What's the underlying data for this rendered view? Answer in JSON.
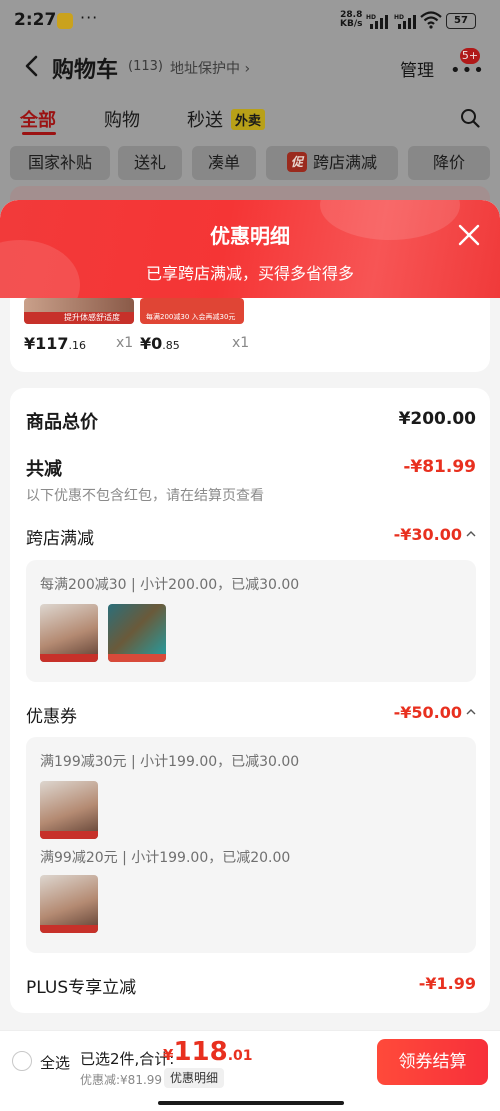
{
  "status_bar": {
    "time": "2:27",
    "more": "···",
    "speed_value": "28.8",
    "speed_unit": "KB/s",
    "battery": "57"
  },
  "header": {
    "title": "购物车",
    "count": "(113)",
    "address_protect": "地址保护中 ›",
    "manage": "管理",
    "badge": "5+"
  },
  "tabs": [
    {
      "label": "全部",
      "active": true
    },
    {
      "label": "购物",
      "active": false
    },
    {
      "label": "秒送",
      "active": false
    }
  ],
  "tab_tag": "外卖",
  "filters": [
    "国家补贴",
    "送礼",
    "凑单",
    "跨店满减",
    "降价"
  ],
  "filter_promo_icon": "促",
  "sheet": {
    "title": "优惠明细",
    "subtitle": "已享跨店满减，买得多省得多"
  },
  "items": [
    {
      "price_int": "¥117",
      "price_dec": ".16",
      "qty": "x1",
      "thumb_text": "提升体感舒适度"
    },
    {
      "price_int": "¥0",
      "price_dec": ".85",
      "qty": "x1",
      "thumb_text": "每满200减30 入会再减30元"
    }
  ],
  "summary": {
    "total_label": "商品总价",
    "total_value": "¥200.00",
    "reduce_label": "共减",
    "reduce_value": "-¥81.99",
    "reduce_note": "以下优惠不包含红包，请在结算页查看",
    "cross_store": {
      "label": "跨店满减",
      "value": "-¥30.00",
      "detail": "每满200减30 | 小计200.00，已减30.00"
    },
    "coupon": {
      "label": "优惠券",
      "value": "-¥50.00",
      "detail_1": "满199减30元 | 小计199.00，已减30.00",
      "detail_2": "满99减20元 | 小计199.00，已减20.00"
    },
    "plus": {
      "label": "PLUS专享立减",
      "value": "-¥1.99"
    }
  },
  "bottom_bar": {
    "select_all": "全选",
    "selected": "已选2件,合计:",
    "total_currency": "¥",
    "total_int": "118",
    "total_dec": ".01",
    "discount": "优惠减:¥81.99",
    "detail_chip": "优惠明细",
    "checkout": "领券结算"
  },
  "colors": {
    "accent_red": "#e8301f",
    "header_red": "#f53535",
    "active_tab_dim": "#9b1212"
  },
  "icons": [
    "back-icon",
    "search-icon",
    "close-icon",
    "chevron-up-icon",
    "more-icon",
    "wifi-icon",
    "signal-icon",
    "battery-icon"
  ]
}
